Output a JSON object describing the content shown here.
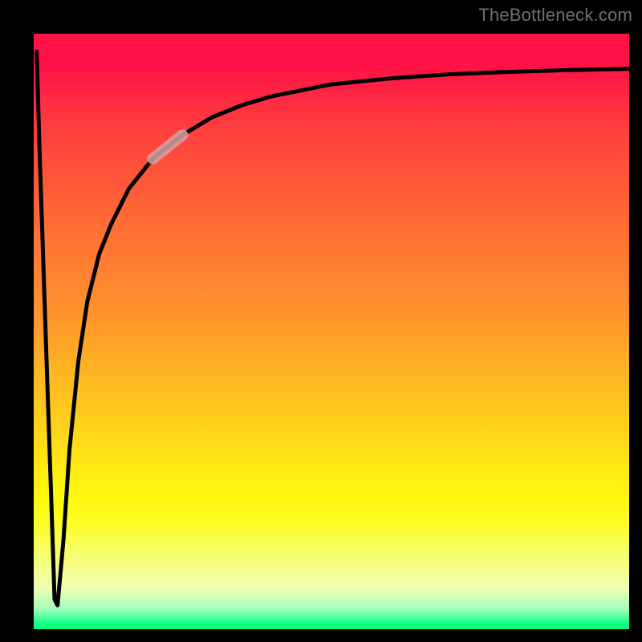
{
  "attribution": "TheBottleneck.com",
  "chart_data": {
    "type": "line",
    "title": "",
    "xlabel": "",
    "ylabel": "",
    "xlim": [
      0,
      100
    ],
    "ylim": [
      0,
      100
    ],
    "grid": false,
    "series": [
      {
        "name": "bottleneck-curve",
        "x": [
          0.5,
          1.0,
          2.0,
          3.0,
          3.5,
          4.0,
          5.0,
          6.0,
          7.5,
          9.0,
          11.0,
          13.0,
          16.0,
          20.0,
          25.0,
          30.0,
          35.0,
          40.0,
          50.0,
          60.0,
          70.0,
          80.0,
          90.0,
          100.0
        ],
        "y": [
          97,
          80,
          50,
          20,
          5,
          4,
          15,
          30,
          45,
          55,
          63,
          68,
          74,
          79,
          83,
          86,
          88,
          89.5,
          91.5,
          92.5,
          93.2,
          93.6,
          93.9,
          94.1
        ]
      }
    ],
    "highlight": {
      "x_range": [
        17,
        26
      ],
      "appearance": "pale-band-on-curve"
    },
    "background_gradient": {
      "direction": "top-to-bottom",
      "stops": [
        {
          "pos": 0.0,
          "color": "#ff1046"
        },
        {
          "pos": 0.3,
          "color": "#ff6736"
        },
        {
          "pos": 0.58,
          "color": "#ffb822"
        },
        {
          "pos": 0.78,
          "color": "#fff80e"
        },
        {
          "pos": 0.93,
          "color": "#f0ffb2"
        },
        {
          "pos": 1.0,
          "color": "#00ff74"
        }
      ]
    }
  }
}
